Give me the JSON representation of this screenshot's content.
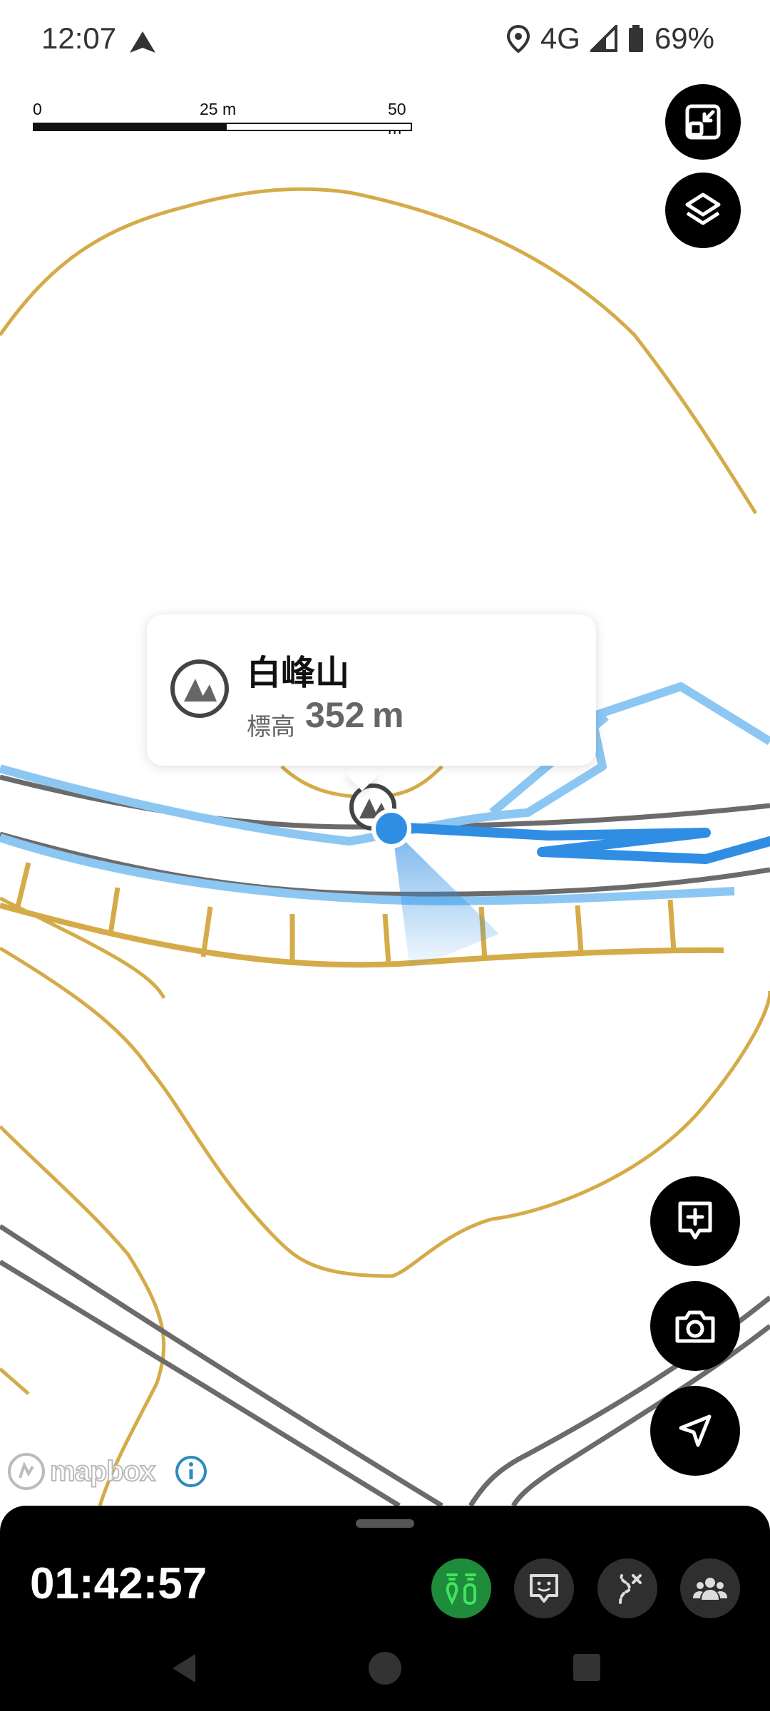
{
  "status_bar": {
    "time": "12:07",
    "network": "4G",
    "battery": "69%",
    "icons": [
      "navigation-arrow-icon",
      "location-pin-icon",
      "signal-icon",
      "battery-icon"
    ]
  },
  "scale_bar": {
    "labels": [
      "0",
      "25 m",
      "50 m"
    ]
  },
  "popup": {
    "title": "白峰山",
    "elevation_label": "標高",
    "elevation_value": "352",
    "elevation_unit": "m",
    "icon": "mountain-icon"
  },
  "map_controls": {
    "top": [
      "fit-screen-icon",
      "layers-icon"
    ],
    "bottom": [
      "add-note-icon",
      "camera-icon",
      "navigate-icon"
    ]
  },
  "attribution": {
    "logo_text": "mapbox",
    "info_icon": "info-icon"
  },
  "bottom_sheet": {
    "timer": "01:42:57",
    "actions": [
      "tracking-icon",
      "face-icon",
      "route-icon",
      "group-icon"
    ]
  },
  "colors": {
    "contour": "#d4ab48",
    "road": "#6b6b6b",
    "track_light": "#8cc7f3",
    "track_dark": "#2f8ee3",
    "active_chip": "#1e8c3a",
    "active_icon": "#3ee65f"
  }
}
